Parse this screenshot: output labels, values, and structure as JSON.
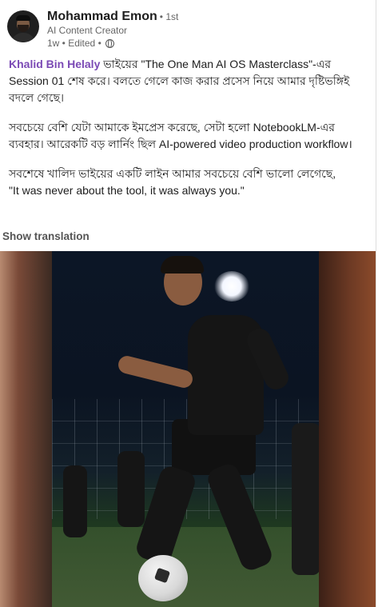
{
  "author": {
    "name": "Mohammad Emon",
    "degree": "• 1st",
    "headline": "AI Content Creator",
    "meta": "1w • Edited •"
  },
  "post": {
    "mention": "Khalid Bin Helaly",
    "paragraph1_rest": " ভাইয়ের \"The One Man AI OS Masterclass\"-এর Session 01 শেষ করে। বলতে গেলে কাজ করার প্রসেস নিয়ে আমার দৃষ্টিভঙ্গিই বদলে গেছে।",
    "paragraph2": "সবচেয়ে বেশি যেটা আমাকে ইমপ্রেস করেছে, সেটা হলো NotebookLM-এর ব্যবহার। আরেকটি বড় লার্নিং ছিল AI-powered video production workflow।",
    "paragraph3_line1": "সবশেষে খালিদ ভাইয়ের একটি লাইন আমার সবচেয়ে বেশি ভালো লেগেছে,",
    "paragraph3_line2": "\"It was never about the tool, it was always you.\""
  },
  "actions": {
    "show_translation": "Show translation"
  },
  "media": {
    "type": "video",
    "description_icon": "soccer-player-image"
  },
  "colors": {
    "mention": "#7b4ab5",
    "secondary_text": "#666666",
    "primary_text": "#1d1d1d"
  },
  "icons": {
    "visibility": "globe-icon"
  }
}
